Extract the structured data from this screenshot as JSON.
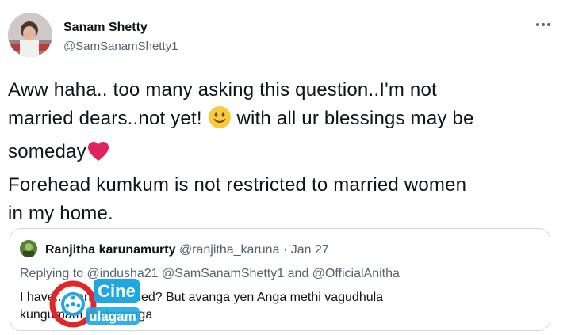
{
  "tweet": {
    "author_name": "Sanam Shetty",
    "author_handle": "@SamSanamShetty1",
    "more_icon": "more-horizontal-icon",
    "body_lines": [
      "Aww haha.. too many asking this question..I'm not",
      "married dears..not yet!",
      "with all ur blessings may be",
      "someday",
      "Forehead kumkum is not restricted to married women",
      "in my home."
    ],
    "emojis": [
      "slightly-smiling-face",
      "red-heart"
    ]
  },
  "quoted_tweet": {
    "author_name": "Ranjitha karunamurty",
    "author_handle": "@ranjitha_karuna",
    "separator": "·",
    "date": "Jan 27",
    "replying_to": "Replying to @indusha21 @SamSanamShetty1 and @OfficialAnitha",
    "text_line1": "I have... Sanam married? But avanga yen Anga methi vagudhula",
    "text_line2": "kungumam vachuranga"
  },
  "watermark": {
    "brand_top": "Cine",
    "brand_bottom": "ulagam",
    "colors": {
      "red": "#e0262b",
      "blue": "#1ea7e1"
    }
  }
}
